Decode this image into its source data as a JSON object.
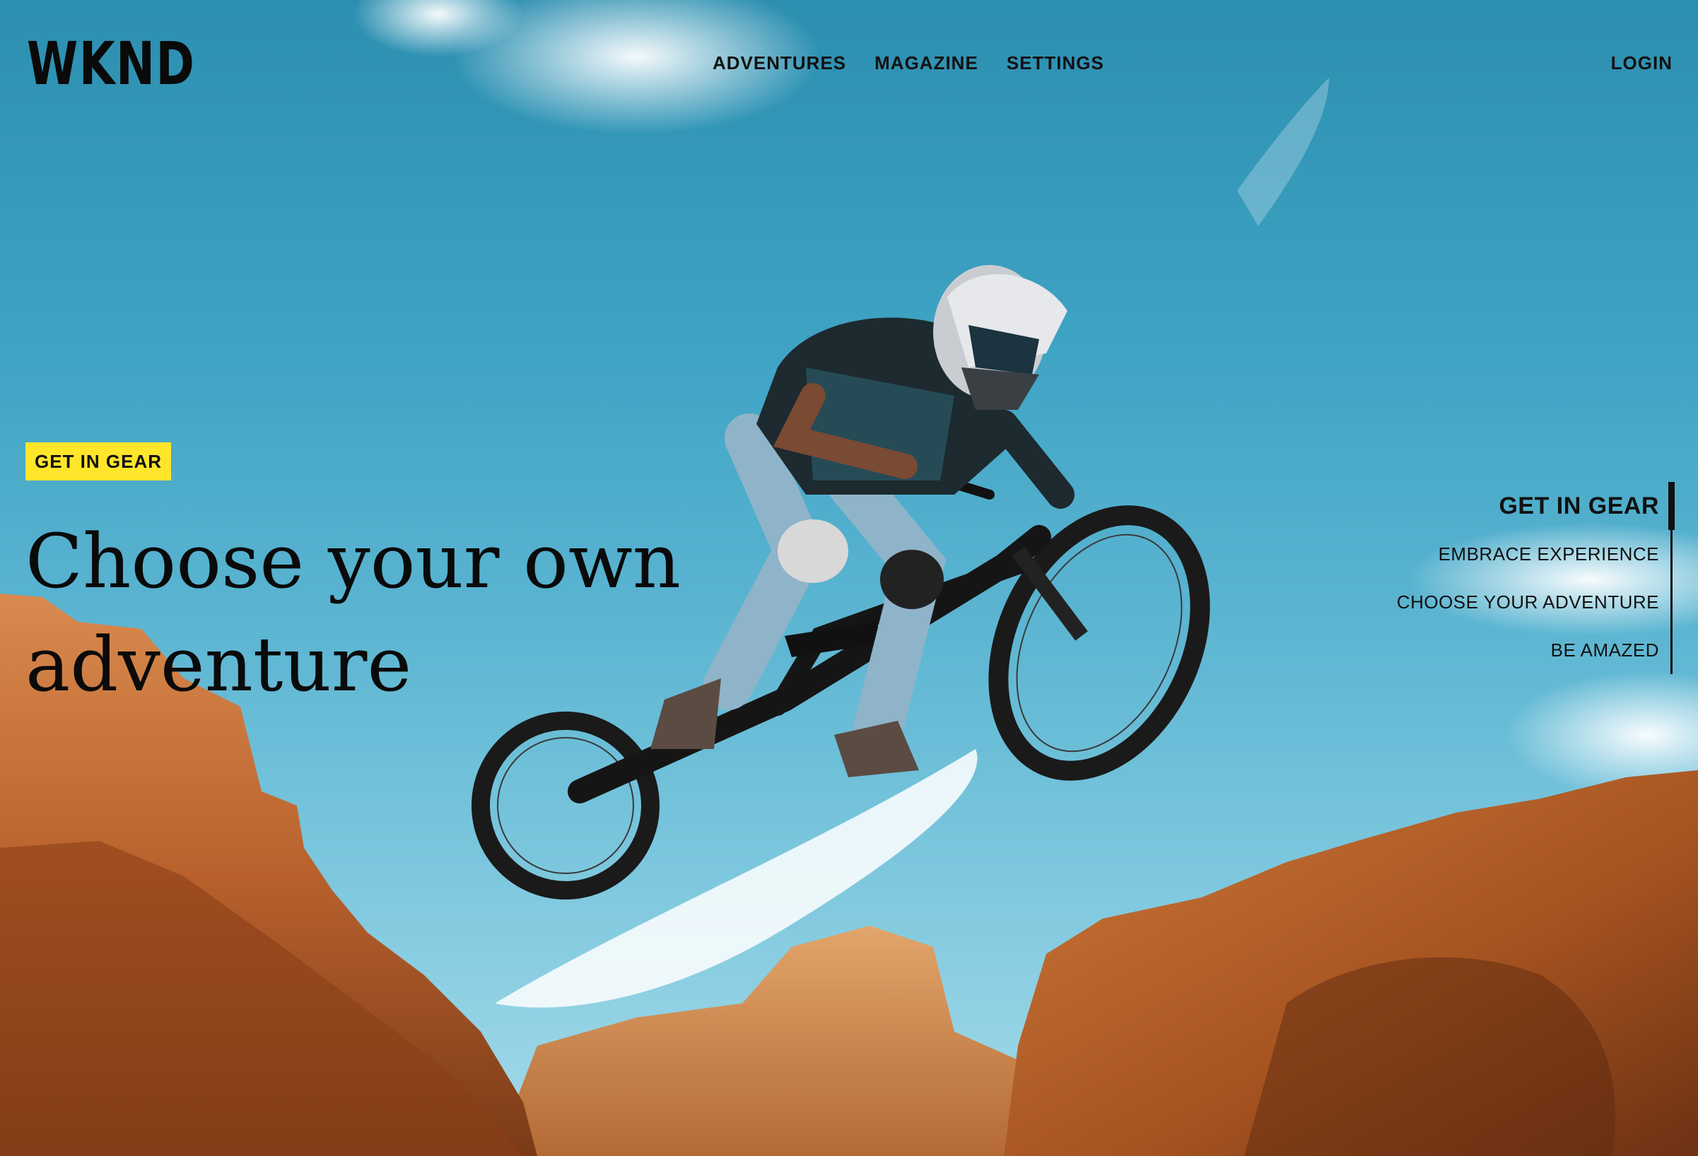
{
  "header": {
    "logo": "WKND",
    "nav": [
      {
        "label": "ADVENTURES"
      },
      {
        "label": "MAGAZINE"
      },
      {
        "label": "SETTINGS"
      }
    ],
    "login_label": "LOGIN"
  },
  "hero": {
    "tag": "GET IN GEAR",
    "headline": "Choose your own adventure",
    "image_icon": "mountain-biker-jump-image"
  },
  "carousel": {
    "items": [
      {
        "label": "GET IN GEAR",
        "active": true
      },
      {
        "label": "EMBRACE EXPERIENCE",
        "active": false
      },
      {
        "label": "CHOOSE YOUR ADVENTURE",
        "active": false
      },
      {
        "label": "BE AMAZED",
        "active": false
      }
    ]
  },
  "colors": {
    "accent": "#ffe62b",
    "text": "#111111",
    "sky": "#3fa3c4",
    "rock": "#c8682c"
  }
}
